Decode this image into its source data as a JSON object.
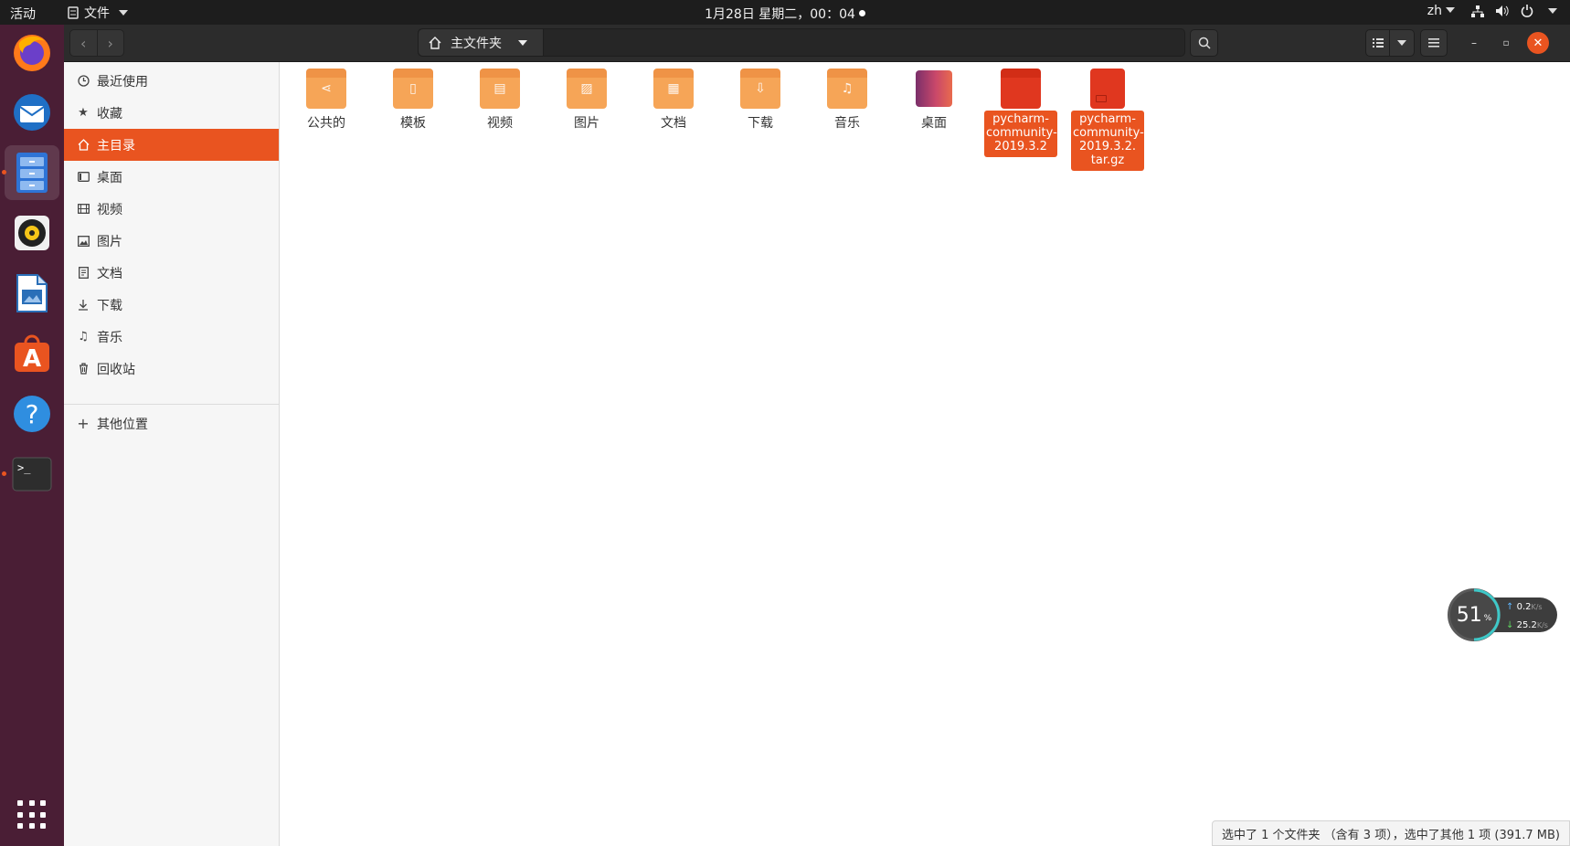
{
  "topbar": {
    "activities": "活动",
    "app_name": "文件",
    "datetime": "1月28日 星期二，00：04",
    "lang": "zh"
  },
  "dock": {
    "apps": [
      "firefox-icon",
      "thunderbird-icon",
      "files-icon",
      "rhythmbox-icon",
      "writer-icon",
      "software-icon",
      "help-icon",
      "terminal-icon"
    ]
  },
  "header": {
    "path_label": "主文件夹"
  },
  "sidebar": {
    "items": [
      {
        "label": "最近使用",
        "icon": "clock-icon"
      },
      {
        "label": "收藏",
        "icon": "star-icon"
      },
      {
        "label": "主目录",
        "icon": "home-icon"
      },
      {
        "label": "桌面",
        "icon": "desktop-icon"
      },
      {
        "label": "视频",
        "icon": "video-icon"
      },
      {
        "label": "图片",
        "icon": "picture-icon"
      },
      {
        "label": "文档",
        "icon": "document-icon"
      },
      {
        "label": "下载",
        "icon": "download-icon"
      },
      {
        "label": "音乐",
        "icon": "music-icon"
      },
      {
        "label": "回收站",
        "icon": "trash-icon"
      }
    ],
    "other": "其他位置"
  },
  "files": [
    {
      "name": "公共的",
      "icon": "share-folder-icon"
    },
    {
      "name": "模板",
      "icon": "templates-folder-icon"
    },
    {
      "name": "视频",
      "icon": "videos-folder-icon"
    },
    {
      "name": "图片",
      "icon": "pictures-folder-icon"
    },
    {
      "name": "文档",
      "icon": "documents-folder-icon"
    },
    {
      "name": "下载",
      "icon": "downloads-folder-icon"
    },
    {
      "name": "音乐",
      "icon": "music-folder-icon"
    },
    {
      "name": "桌面",
      "icon": "desktop-folder-icon"
    },
    {
      "name": "pycharm-community-2019.3.2",
      "icon": "folder-icon"
    },
    {
      "name": "pycharm-community-2019.3.2.tar.gz",
      "icon": "archive-icon"
    }
  ],
  "status": "选中了 1 个文件夹 （含有 3 项），选中了其他 1 项 (391.7 MB)",
  "netwidget": {
    "cpu": "51",
    "cpu_unit": "%",
    "up": "0.2",
    "down": "25.2",
    "unit": "K/s"
  },
  "colors": {
    "accent": "#e95420",
    "dock": "#4a1e35",
    "folder": "#f6a557"
  }
}
